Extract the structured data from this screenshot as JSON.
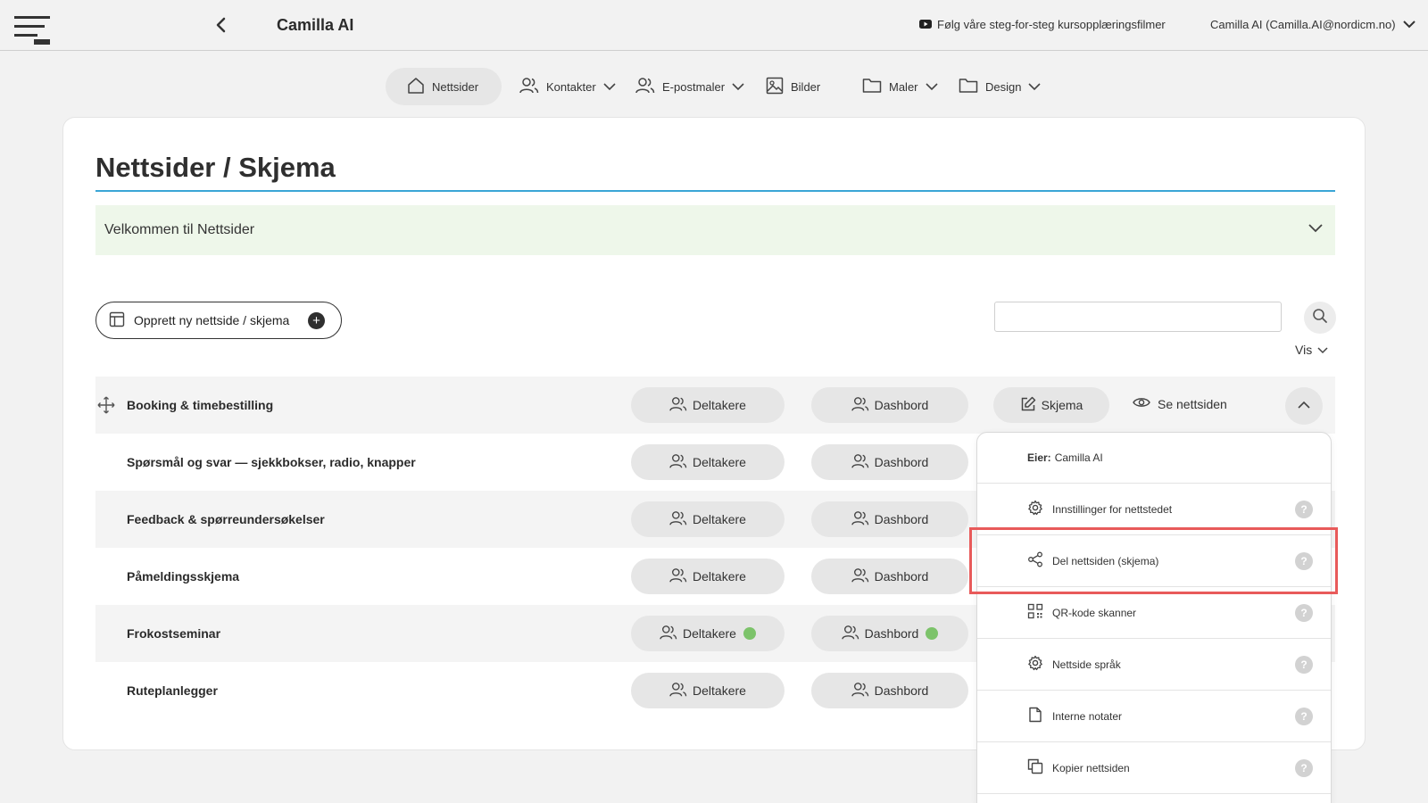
{
  "topbar": {
    "title": "Camilla AI",
    "tutorial_link": "Følg våre steg-for-steg kursopplæringsfilmer",
    "user": "Camilla AI (Camilla.AI@nordicm.no)"
  },
  "nav": {
    "items": [
      {
        "label": "Nettsider",
        "icon": "home-icon",
        "active": true
      },
      {
        "label": "Kontakter",
        "icon": "users-icon",
        "dropdown": true
      },
      {
        "label": "E-postmaler",
        "icon": "users-icon",
        "dropdown": true
      },
      {
        "label": "Bilder",
        "icon": "image-icon"
      },
      {
        "label": "Maler",
        "icon": "folder-icon",
        "dropdown": true
      },
      {
        "label": "Design",
        "icon": "folder-icon",
        "dropdown": true
      }
    ]
  },
  "page": {
    "title": "Nettsider / Skjema",
    "welcome": "Velkommen til Nettsider",
    "create_button": "Opprett ny nettside / skjema",
    "search_placeholder": "",
    "vis_label": "Vis"
  },
  "rows": [
    {
      "name": "Booking & timebestilling",
      "deltakere": "Deltakere",
      "dashbord": "Dashbord",
      "skjema": "Skjema",
      "see": "Se nettsiden",
      "expanded": true
    },
    {
      "name": "Spørsmål og svar — sjekkbokser, radio, knapper",
      "deltakere": "Deltakere",
      "dashbord": "Dashbord"
    },
    {
      "name": "Feedback & spørreundersøkelser",
      "deltakere": "Deltakere",
      "dashbord": "Dashbord"
    },
    {
      "name": "Påmeldingsskjema",
      "deltakere": "Deltakere",
      "dashbord": "Dashbord"
    },
    {
      "name": "Frokostseminar",
      "deltakere": "Deltakere",
      "dashbord": "Dashbord",
      "active_dot": true
    },
    {
      "name": "Ruteplanlegger",
      "deltakere": "Deltakere",
      "dashbord": "Dashbord"
    }
  ],
  "panel": {
    "owner_label": "Eier:",
    "owner_name": "Camilla AI",
    "items": [
      {
        "label": "Innstillinger for nettstedet",
        "icon": "gear-icon"
      },
      {
        "label": "Del nettsiden (skjema)",
        "icon": "share-icon",
        "highlighted": true
      },
      {
        "label": "QR-kode skanner",
        "icon": "qr-code-icon"
      },
      {
        "label": "Nettside språk",
        "icon": "gear-icon"
      },
      {
        "label": "Interne notater",
        "icon": "document-icon"
      },
      {
        "label": "Kopier nettsiden",
        "icon": "copy-icon"
      }
    ],
    "help_glyph": "?"
  },
  "colors": {
    "accent_rule": "#3aa6d6",
    "welcome_bg": "#eef7ea",
    "status_dot": "#7cc36a",
    "highlight": "#e85a5a"
  }
}
